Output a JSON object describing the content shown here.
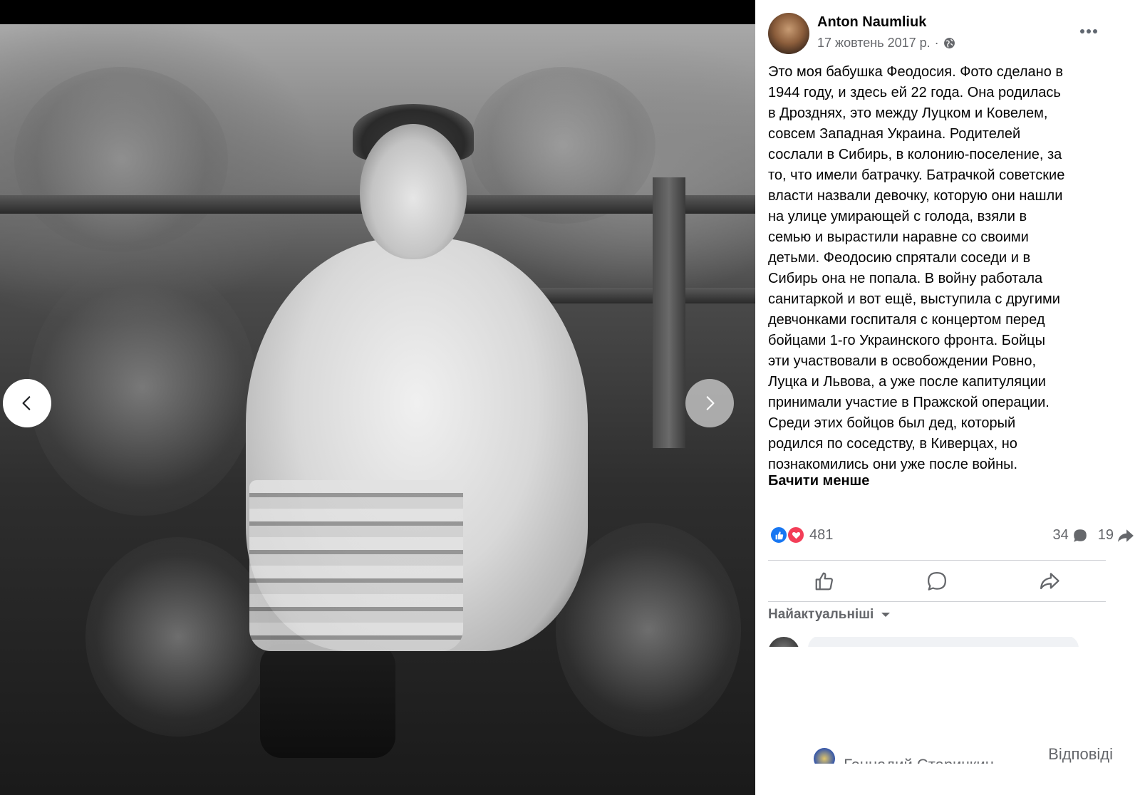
{
  "post": {
    "author": "Anton Naumliuk",
    "date": "17 жовтень 2017 р.",
    "separator": "·",
    "privacy_icon": "globe-icon",
    "more_icon": "ellipsis-icon",
    "text": "Это моя бабушка Феодосия. Фото сделано в\n1944 году, и здесь ей 22 года. Она родилась\nв Дрозднях, это между Луцком и Ковелем,\nсовсем Западная Украина. Родителей\nсослали в Сибирь, в колонию-поселение, за\nто, что имели батрачку. Батрачкой советские\nвласти назвали девочку, которую они нашли\nна улице умирающей с голода, взяли в\nсемью и вырастили наравне со своими\nдетьми. Феодосию спрятали соседи и в\nСибирь она не попала. В войну работала\nсанитаркой и вот ещё, выступила с другими\nдевчонками госпиталя с концертом перед\nбойцами 1-го Украинского фронта. Бойцы\nэти участвовали в освобождении Ровно,\nЛуцка и Львова, а уже после капитуляции\nпринимали участие в Пражской операции.\nСреди этих бойцов был дед, который\nродился по соседству, в Киверцах, но\nпознакомились они уже после войны.",
    "see_less": "Бачити менше"
  },
  "stats": {
    "reactions_count": "481",
    "comments_count": "34",
    "shares_count": "19",
    "like_color": "#1877f2",
    "love_color": "#f33e58"
  },
  "comments": {
    "sort_label": "Найактуальніші",
    "reply_partial_name": "Геннадий Старичкин",
    "reply_label": "Відповіді"
  },
  "viewer": {
    "prev_icon": "chevron-left-icon",
    "next_icon": "chevron-right-icon"
  }
}
